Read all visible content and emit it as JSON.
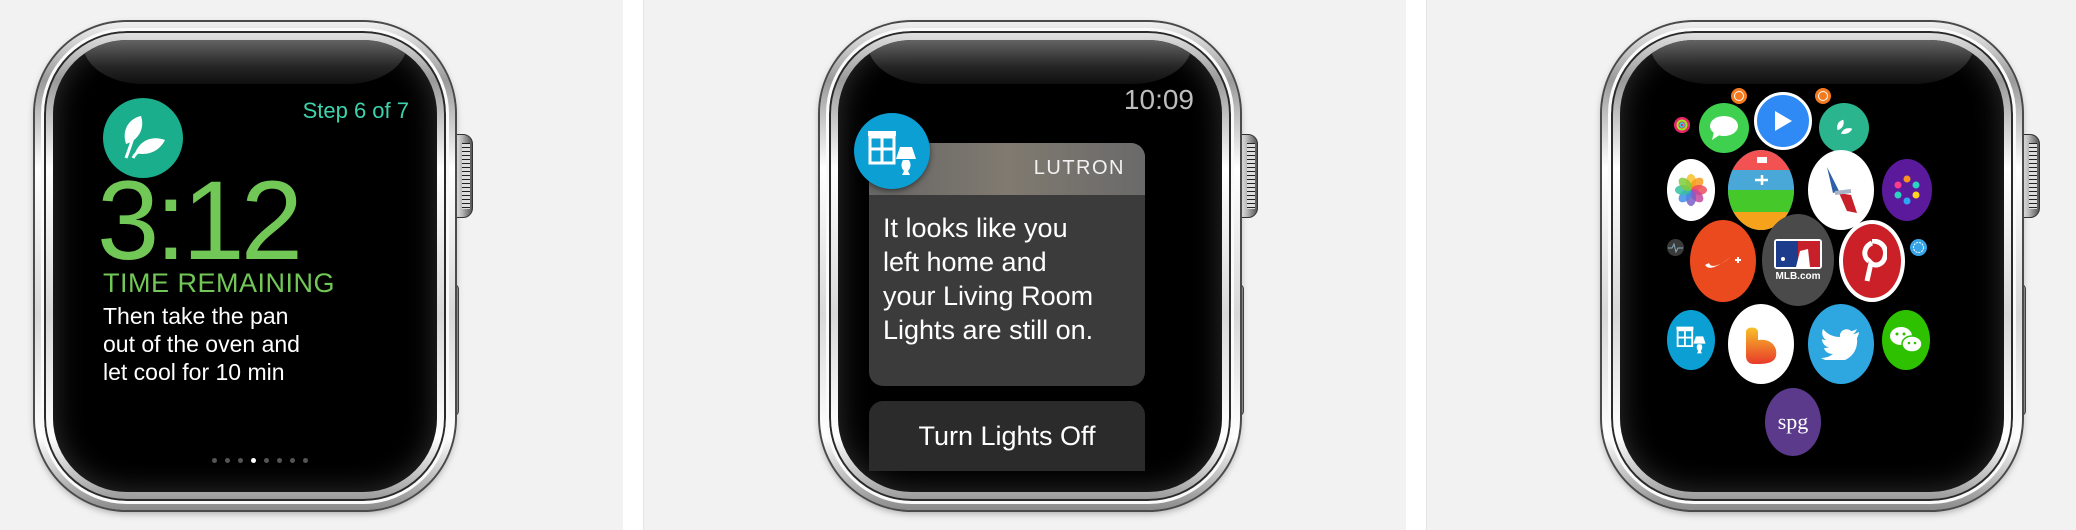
{
  "screens": [
    {
      "name": "Recipe timer",
      "app_icon": "leaves-icon",
      "step": "Step 6 of 7",
      "time": "3:12",
      "time_label": "TIME REMAINING",
      "instructions": [
        "Then take the pan",
        "out of the oven and",
        "let cool for 10 min"
      ],
      "page_count": 8,
      "current_page": 4,
      "colors": {
        "accent_green": "#72c856",
        "step_teal": "#3ed3ad",
        "icon_bg": "#1aae8c"
      }
    },
    {
      "name": "Lutron notification",
      "app_icon": "window-lamp-icon",
      "clock": "10:09",
      "app_name": "LUTRON",
      "message": [
        "It looks like you",
        "left home and",
        "your Living Room",
        "Lights are still on."
      ],
      "action_label": "Turn Lights Off",
      "colors": {
        "icon_bg": "#0b9fd4"
      }
    },
    {
      "name": "Home screen app grid",
      "apps": [
        {
          "id": "stopwatch",
          "icon": "stopwatch-icon",
          "color": "#f47a1f"
        },
        {
          "id": "timer",
          "icon": "timer-icon",
          "color": "#f47a1f"
        },
        {
          "id": "activity",
          "icon": "activity-rings-icon",
          "color": "#e8246b"
        },
        {
          "id": "messages",
          "icon": "speech-bubble-icon",
          "color": "#3fd04f"
        },
        {
          "id": "player",
          "icon": "play-icon",
          "color": "#2f8af5"
        },
        {
          "id": "recipe",
          "icon": "leaves-icon",
          "color": "#2bb58f"
        },
        {
          "id": "photos",
          "icon": "photos-flower-icon",
          "color": "#ffffff"
        },
        {
          "id": "passbook",
          "icon": "passbook-icon",
          "color": "#4aa8d8"
        },
        {
          "id": "american-airlines",
          "icon": "aa-flight-icon",
          "color": "#ffffff"
        },
        {
          "id": "dots",
          "icon": "colored-dots-icon",
          "color": "#5b1a9c"
        },
        {
          "id": "heart-rate",
          "icon": "heartbeat-icon",
          "color": "#3a3a3a"
        },
        {
          "id": "nike-plus",
          "icon": "swoosh-icon",
          "color": "#ea4a1e",
          "label": "+"
        },
        {
          "id": "mlb",
          "icon": "mlb-logo-icon",
          "color": "#4a4a4a",
          "label": "MLB.com"
        },
        {
          "id": "pinterest",
          "icon": "pinterest-p-icon",
          "color": "#cb2027"
        },
        {
          "id": "settings",
          "icon": "gear-icon",
          "color": "#37a4e8"
        },
        {
          "id": "lutron",
          "icon": "window-lamp-icon",
          "color": "#0b9fd4"
        },
        {
          "id": "dreams",
          "icon": "d-shape-icon",
          "color": "#ffffff"
        },
        {
          "id": "twitter",
          "icon": "twitter-bird-icon",
          "color": "#2ea6e0"
        },
        {
          "id": "wechat",
          "icon": "wechat-bubbles-icon",
          "color": "#2dc100"
        },
        {
          "id": "spg",
          "icon": "spg-logo-icon",
          "color": "#5b3a8c",
          "label": "spg"
        }
      ]
    }
  ]
}
